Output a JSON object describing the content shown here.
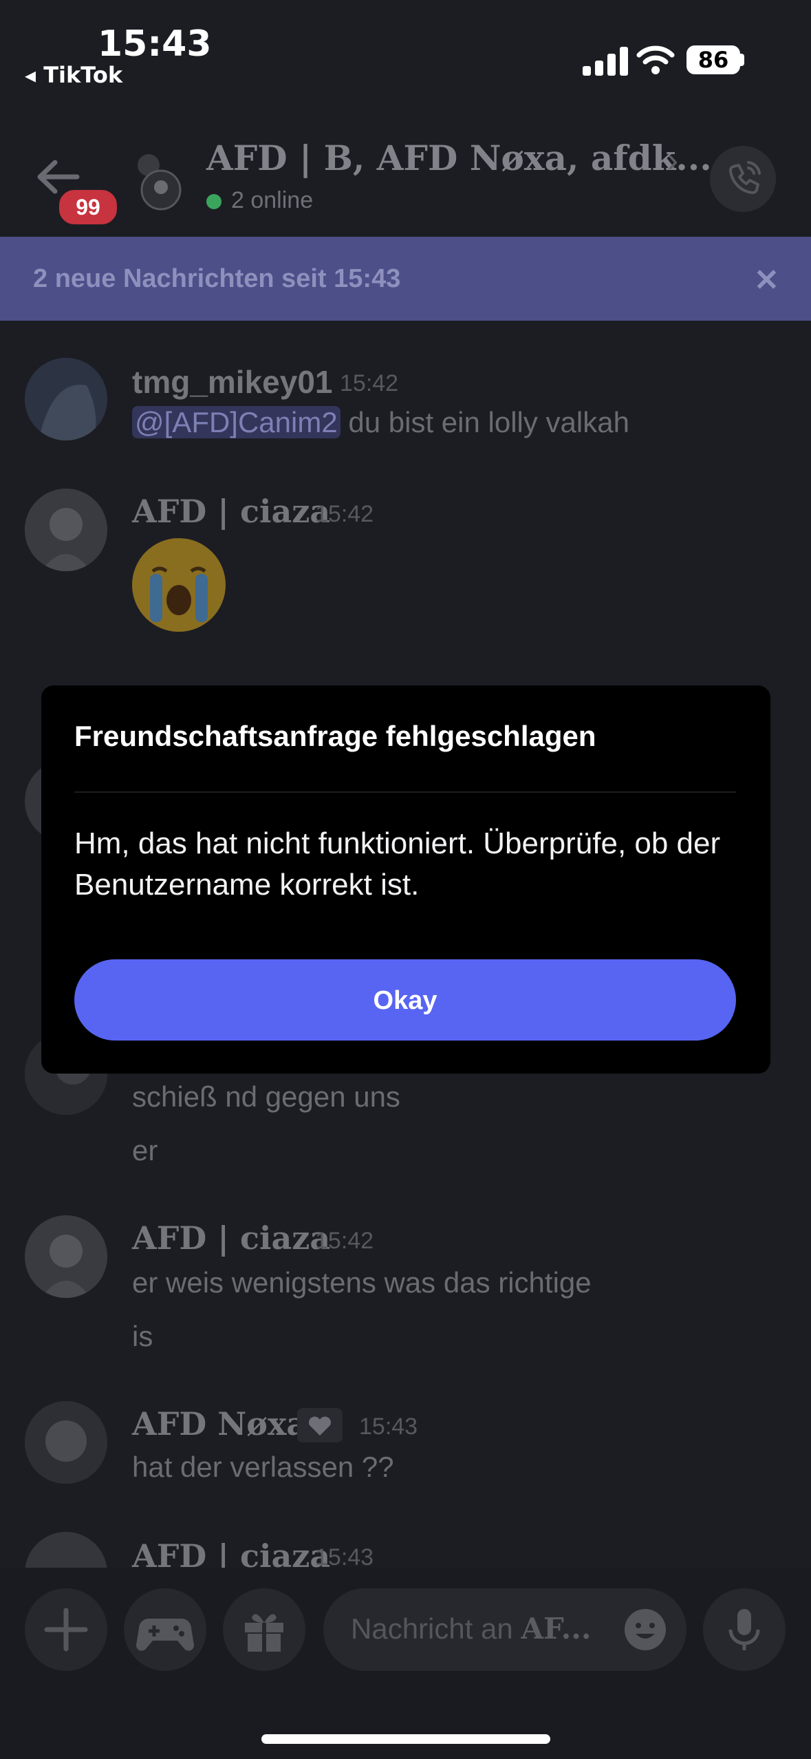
{
  "status_bar": {
    "time": "15:43",
    "back_app": "◂ TikTok",
    "battery": "86"
  },
  "header": {
    "unread_badge": "99",
    "title": "AFD | B, AFD Nøxa, afdk...",
    "chevron": "›",
    "online": "2 online"
  },
  "banner": {
    "text": "2 neue Nachrichten seit 15:43",
    "close": "✕"
  },
  "messages": [
    {
      "user": "tmg_mikey01",
      "time": "15:42",
      "mention": "@[AFD]Canim2",
      "text": " du bist ein lolly valkah"
    },
    {
      "user": "AFD | ciaza",
      "time": "15:42",
      "emoji": "loudly-crying-face"
    },
    {
      "lines": [
        "schieß nd gegen uns",
        "er"
      ]
    },
    {
      "user": "AFD | ciaza",
      "time": "15:42",
      "lines": [
        "er weis wenigstens was das richtige",
        "is"
      ]
    },
    {
      "user": "AFD Nøxa",
      "time": "15:43",
      "text": "hat der verlassen ??"
    },
    {
      "user": "AFD | ciaza",
      "time": "15:43"
    }
  ],
  "dialog": {
    "title": "Freundschaftsanfrage fehlgeschlagen",
    "body": "Hm, das hat nicht funktioniert. Überprüfe, ob der Benutzername korrekt ist.",
    "button": "Okay"
  },
  "composer": {
    "placeholder_prefix": "Nachricht an ",
    "placeholder_target": "AF..."
  },
  "icons": [
    "back-arrow-icon",
    "group-avatar-icon",
    "phone-call-icon",
    "close-icon",
    "plus-icon",
    "gamepad-icon",
    "gift-icon",
    "emoji-icon",
    "microphone-icon"
  ],
  "colors": {
    "accent": "#5865f2",
    "banner": "#4c4f88",
    "online": "#3ba55d",
    "badge": "#c7333e",
    "background": "#1c1d23"
  }
}
